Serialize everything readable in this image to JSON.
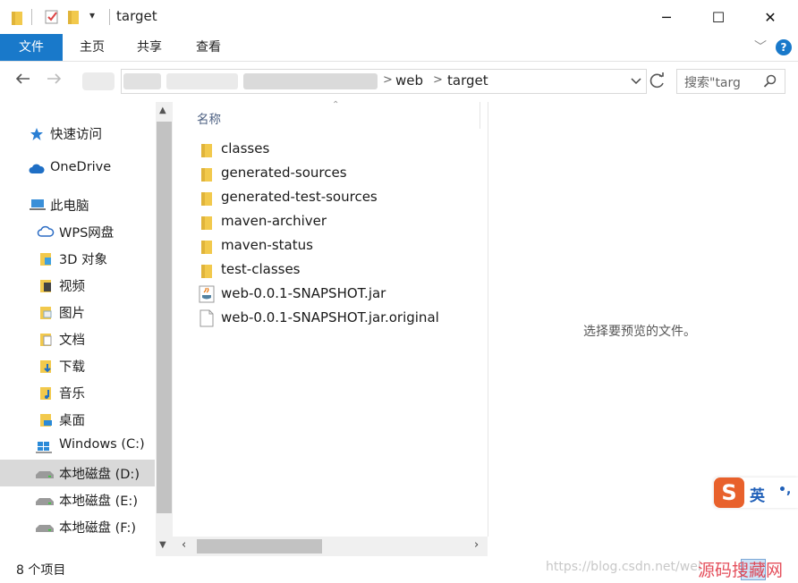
{
  "window": {
    "title": "target",
    "minimize_glyph": "─",
    "maximize_glyph": "☐",
    "close_glyph": "✕"
  },
  "ribbon": {
    "tabs": [
      "文件",
      "主页",
      "共享",
      "查看"
    ],
    "file_tab_color": "#1979ca",
    "expand_glyph": "﹀",
    "help_glyph": "?"
  },
  "address": {
    "crumbs": [
      "web",
      "target"
    ],
    "separator": ">",
    "search_placeholder": "搜索\"targ"
  },
  "nav": {
    "items": [
      {
        "label": "快速访问",
        "icon": "star-icon"
      },
      {
        "label": "OneDrive",
        "icon": "cloud-icon"
      },
      {
        "label": "此电脑",
        "icon": "computer-icon"
      },
      {
        "label": "WPS网盘",
        "icon": "cloud-outline-icon"
      },
      {
        "label": "3D 对象",
        "icon": "3d-folder-icon"
      },
      {
        "label": "视频",
        "icon": "video-folder-icon"
      },
      {
        "label": "图片",
        "icon": "pictures-folder-icon"
      },
      {
        "label": "文档",
        "icon": "documents-folder-icon"
      },
      {
        "label": "下载",
        "icon": "downloads-folder-icon"
      },
      {
        "label": "音乐",
        "icon": "music-folder-icon"
      },
      {
        "label": "桌面",
        "icon": "desktop-folder-icon"
      },
      {
        "label": "Windows (C:)",
        "icon": "windows-drive-icon"
      },
      {
        "label": "本地磁盘 (D:)",
        "icon": "drive-icon",
        "selected": true
      },
      {
        "label": "本地磁盘 (E:)",
        "icon": "drive-icon"
      },
      {
        "label": "本地磁盘 (F:)",
        "icon": "drive-icon"
      }
    ]
  },
  "filelist": {
    "column_header": "名称",
    "files": [
      {
        "name": "classes",
        "type": "folder"
      },
      {
        "name": "generated-sources",
        "type": "folder"
      },
      {
        "name": "generated-test-sources",
        "type": "folder"
      },
      {
        "name": "maven-archiver",
        "type": "folder"
      },
      {
        "name": "maven-status",
        "type": "folder"
      },
      {
        "name": "test-classes",
        "type": "folder"
      },
      {
        "name": "web-0.0.1-SNAPSHOT.jar",
        "type": "jar"
      },
      {
        "name": "web-0.0.1-SNAPSHOT.jar.original",
        "type": "file"
      }
    ]
  },
  "preview": {
    "message": "选择要预览的文件。"
  },
  "status": {
    "item_count": "8 个项目",
    "watermark": "https://blog.csdn.net/wei",
    "brand": "源码搜藏网"
  },
  "ime": {
    "logo": "S",
    "mode": "英",
    "punct": "•,"
  },
  "colors": {
    "folder": "#f2c94c",
    "selected_bg": "#d9d9d9",
    "accent": "#1979ca",
    "ime_logo": "#e8612c"
  }
}
